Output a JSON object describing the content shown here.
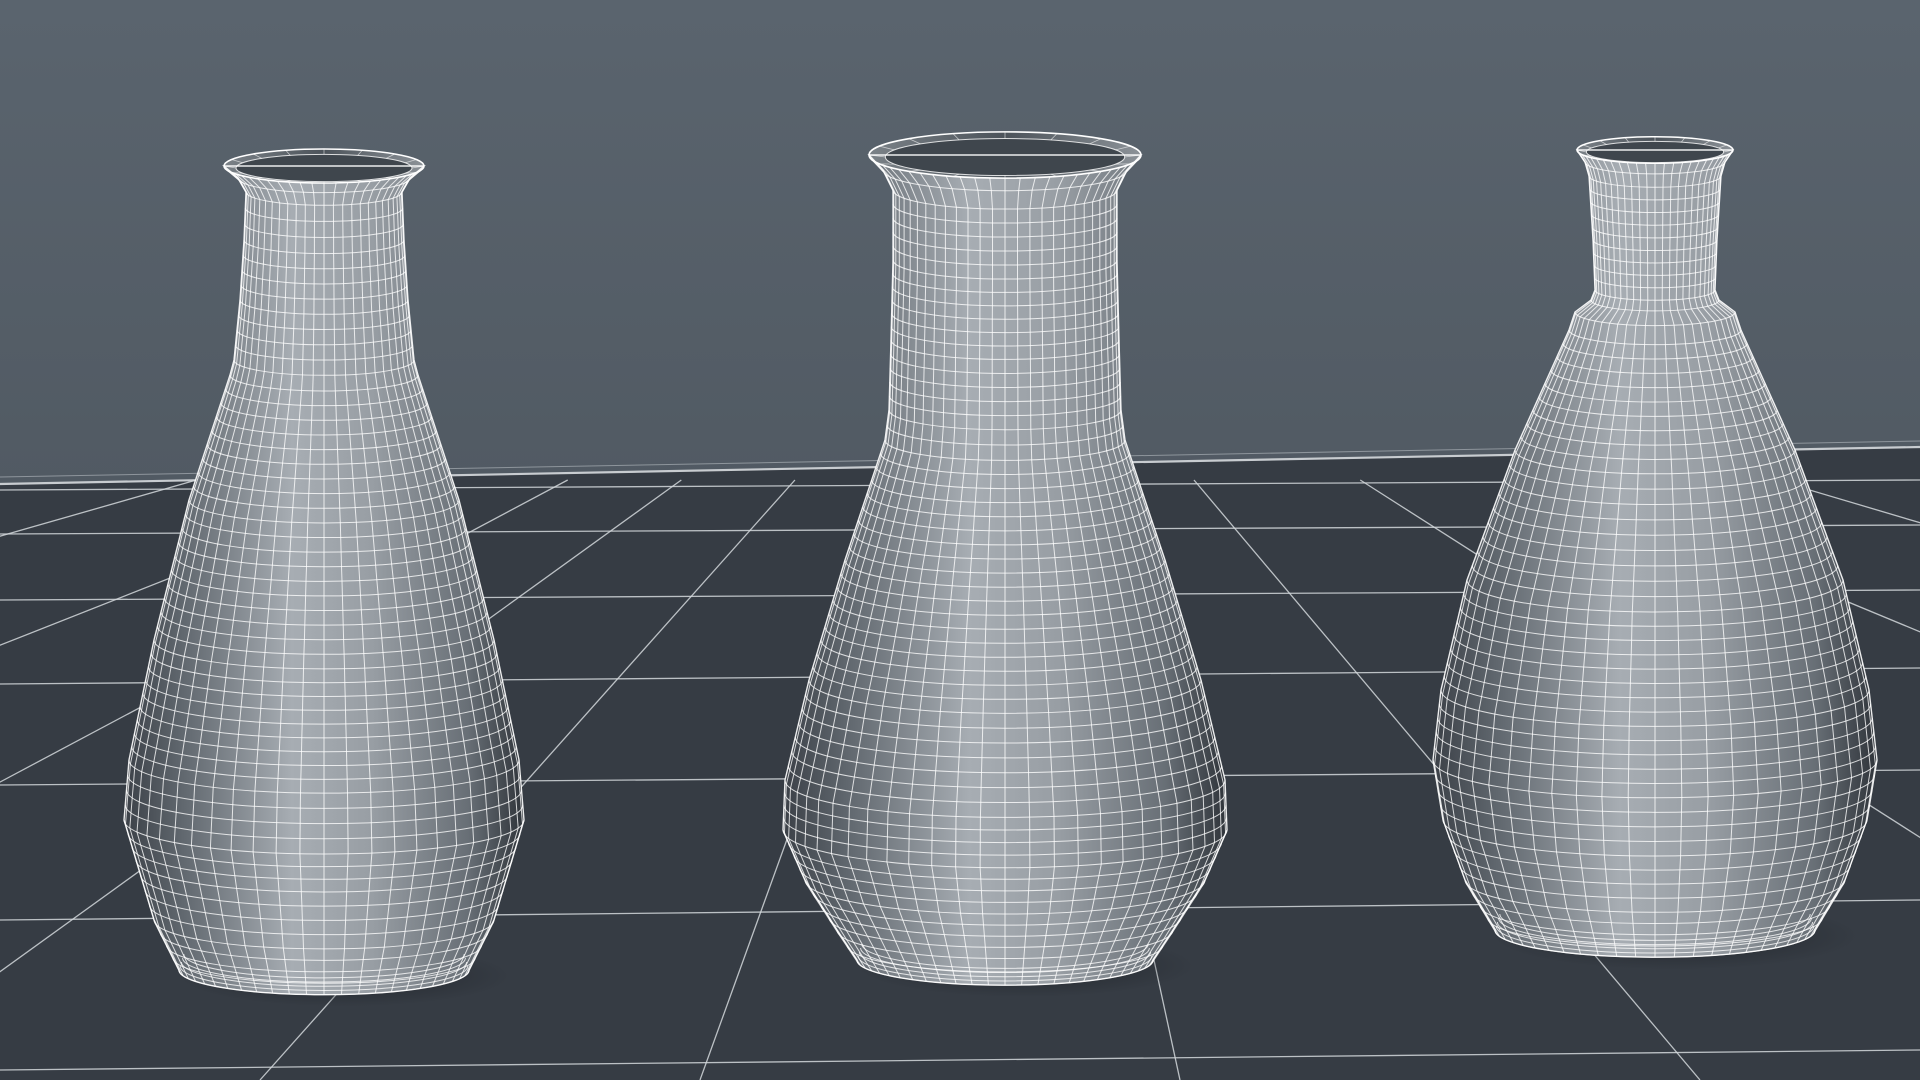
{
  "scene": {
    "colors": {
      "wall_top": "#5a646e",
      "wall_bottom": "#515a63",
      "floor": "#363c44",
      "floor_grid": "#d4d8dc",
      "baseboard": "#c8ccd0",
      "wire": "#ffffff",
      "surface_dark": "#3b4047",
      "surface_light": "#a7adb3"
    },
    "objects": [
      {
        "name": "flask-left",
        "kind": "erlenmeyer-flask",
        "neck": "flared-rim"
      },
      {
        "name": "flask-middle",
        "kind": "erlenmeyer-flask",
        "neck": "wide-flared-rim"
      },
      {
        "name": "flask-right",
        "kind": "erlenmeyer-flask",
        "neck": "ground-glass-joint"
      }
    ]
  }
}
